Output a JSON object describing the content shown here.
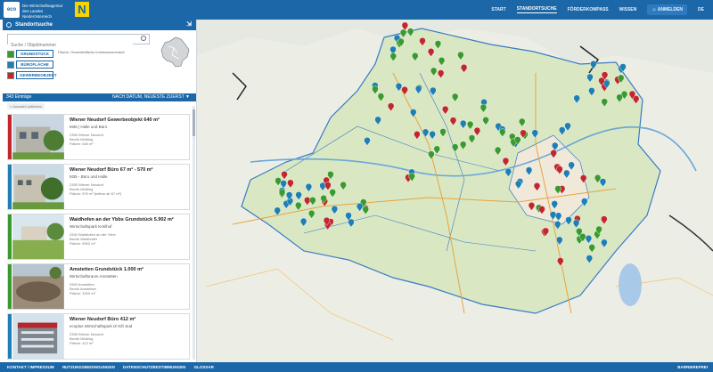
{
  "header": {
    "logo_text": "eco plus",
    "brand_line1": "Die Wirtschaftsagentur",
    "brand_line2": "des Landes Niederösterreich",
    "noe_logo": "N",
    "nav": [
      "START",
      "STANDORTSUCHE",
      "FÖRDERKOMPASS",
      "WISSEN"
    ],
    "login": "ANMELDEN",
    "lang": "DE"
  },
  "panel": {
    "title": "Standortsuche",
    "search_placeholder": "Suche / Objektnummer",
    "chips": [
      {
        "label": "GRUNDSTÜCK",
        "color": "#3b9a2f"
      },
      {
        "label": "BÜROFLÄCHE",
        "color": "#1f7fb4"
      },
      {
        "label": "GEWERBEOBJEKT",
        "color": "#c1272d"
      }
    ],
    "chip_note": "Fläche: Gewerbefläche Immissionsneutral",
    "count": "343 Einträge",
    "sort": "NACH DATUM, NEUESTE ZUERST",
    "filter_tag": "× Auswahl aufheben"
  },
  "listings": [
    {
      "title": "Wiener Neudorf Gewerbeobjekt 640 m²",
      "sub": "M35 | Halle und Büro",
      "d1": "2355 Wiener Neudorf",
      "d2": "Bezirk Mödling",
      "d3": "Fläche: 640 m²",
      "color": "#c1272d"
    },
    {
      "title": "Wiener Neudorf Büro 67 m² - 570 m²",
      "sub": "M35 - Büro und Halle",
      "d1": "2355 Wiener Neudorf",
      "d2": "Bezirk Mödling",
      "d3": "Fläche: 570 m² (teilbar ab 67 m²)",
      "color": "#1f7fb4"
    },
    {
      "title": "Waidhofen an der Ybbs Grundstück 5.902 m²",
      "sub": "Wirtschaftspark Kreilhof",
      "d1": "3340 Waidhofen an der Ybbs",
      "d2": "Bezirk Waidhofen",
      "d3": "Fläche: 5902 m²",
      "color": "#3b9a2f"
    },
    {
      "title": "Amstetten Grundstück 1.000 m²",
      "sub": "Wirtschaftsraum Amstetten",
      "d1": "3300 Amstetten",
      "d2": "Bezirk Amstetten",
      "d3": "Fläche: 1000 m²",
      "color": "#3b9a2f"
    },
    {
      "title": "Wiener Neudorf Büro 412 m²",
      "sub": "ecoplus Wirtschaftspark IZ NÖ Süd",
      "d1": "2355 Wiener Neudorf",
      "d2": "Bezirk Mödling",
      "d3": "Fläche: 412 m²",
      "color": "#1f7fb4"
    }
  ],
  "footer": {
    "links": [
      "KONTAKT / IMPRESSUM",
      "NUTZUNGSBEDINGUNGEN",
      "DATENSCHUTZBESTIMMUNGEN",
      "GLOSSAR"
    ],
    "right": "BARRIEREFREI"
  }
}
